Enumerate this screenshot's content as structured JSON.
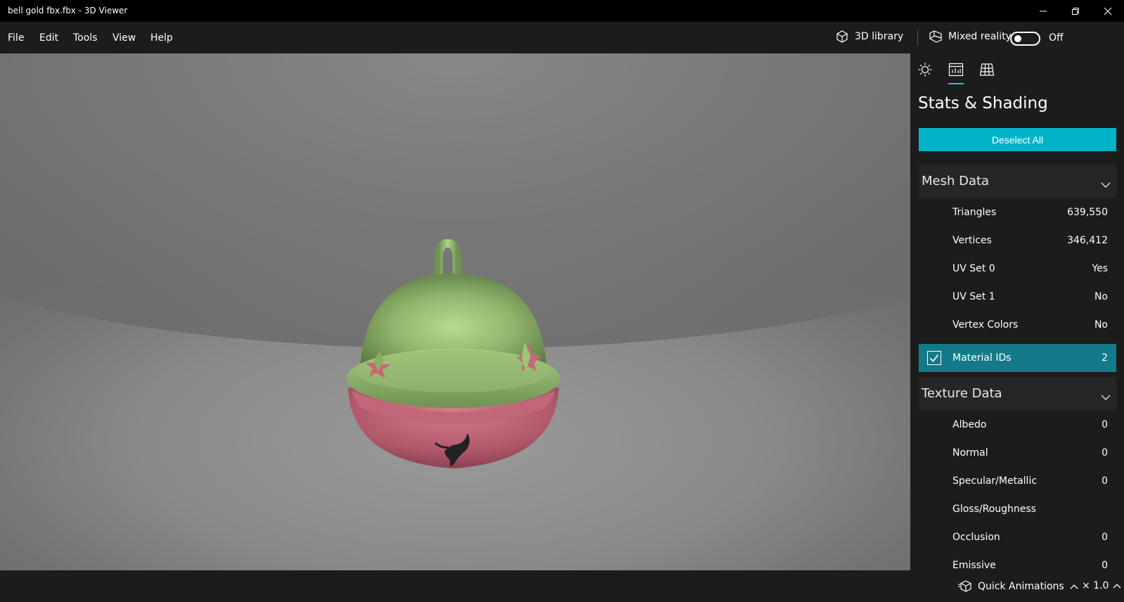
{
  "window": {
    "title": "bell gold fbx.fbx - 3D Viewer"
  },
  "menu": {
    "items": [
      "File",
      "Edit",
      "Tools",
      "View",
      "Help"
    ],
    "library_label": "3D library",
    "mixed_reality_label": "Mixed reality",
    "mixed_reality_state": "Off"
  },
  "panel": {
    "title": "Stats & Shading",
    "deselect_label": "Deselect All",
    "accent_color": "#00b4c8",
    "mesh": {
      "title": "Mesh Data",
      "rows": [
        {
          "label": "Triangles",
          "value": "639,550"
        },
        {
          "label": "Vertices",
          "value": "346,412"
        },
        {
          "label": "UV Set 0",
          "value": "Yes"
        },
        {
          "label": "UV Set 1",
          "value": "No"
        },
        {
          "label": "Vertex Colors",
          "value": "No"
        },
        {
          "label": "Material IDs",
          "value": "2",
          "checked": true
        }
      ]
    },
    "texture": {
      "title": "Texture Data",
      "rows": [
        {
          "label": "Albedo",
          "value": "0"
        },
        {
          "label": "Normal",
          "value": "0"
        },
        {
          "label": "Specular/Metallic",
          "value": "0"
        },
        {
          "label": "Gloss/Roughness",
          "value": ""
        },
        {
          "label": "Occlusion",
          "value": "0"
        },
        {
          "label": "Emissive",
          "value": "0"
        }
      ]
    }
  },
  "statusbar": {
    "quick_animations_label": "Quick Animations",
    "speed_label": "× 1.0"
  }
}
